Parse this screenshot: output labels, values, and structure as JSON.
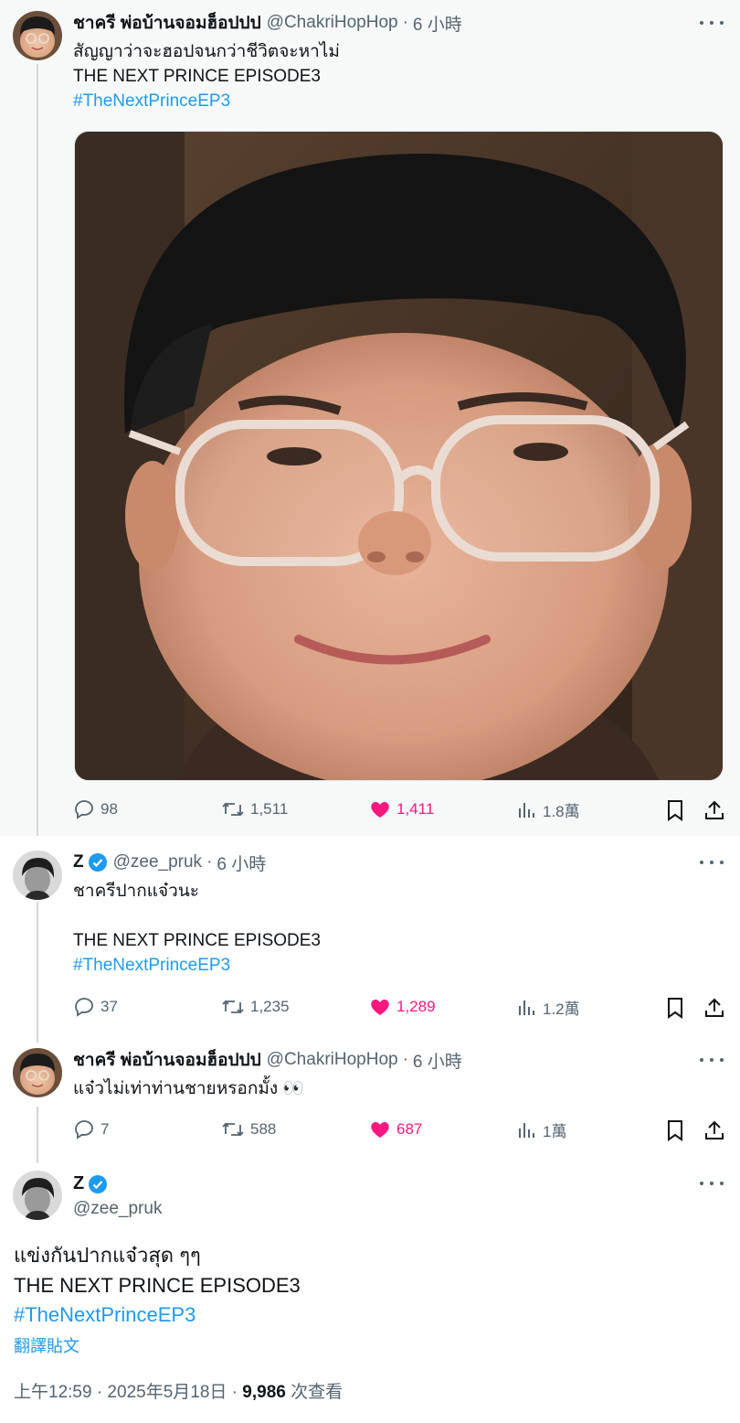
{
  "tweets": [
    {
      "name": "ชาครี พ่อบ้านจอมฮ็อปปป",
      "handle": "@ChakriHopHop",
      "time": "6 小時",
      "lines": [
        "สัญญาว่าจะฮอปจนกว่าชีวิตจะหาไม่",
        "THE NEXT PRINCE EPISODE3"
      ],
      "hashtag": "#TheNextPrinceEP3",
      "stats": {
        "replies": "98",
        "reposts": "1,511",
        "likes": "1,411",
        "views": "1.8萬"
      }
    },
    {
      "name": "Z",
      "handle": "@zee_pruk",
      "time": "6 小時",
      "lines": [
        "ชาครีปากแจ๋วนะ",
        "",
        "THE NEXT PRINCE EPISODE3"
      ],
      "hashtag": "#TheNextPrinceEP3",
      "stats": {
        "replies": "37",
        "reposts": "1,235",
        "likes": "1,289",
        "views": "1.2萬"
      }
    },
    {
      "name": "ชาครี พ่อบ้านจอมฮ็อปปป",
      "handle": "@ChakriHopHop",
      "time": "6 小時",
      "lines": [
        "แจ๋วไม่เท่าท่านชายหรอกมั้ง 👀"
      ],
      "stats": {
        "replies": "7",
        "reposts": "588",
        "likes": "687",
        "views": "1萬"
      }
    }
  ],
  "main": {
    "name": "Z",
    "handle": "@zee_pruk",
    "lines": [
      "แข่งกันปากแจ๋วสุด ๆๆ",
      "THE NEXT PRINCE EPISODE3"
    ],
    "hashtag": "#TheNextPrinceEP3",
    "translate": "翻譯貼文",
    "timestamp": "上午12:59 · 2025年5月18日 · ",
    "views_count": "9,986",
    "views_label": " 次查看"
  },
  "separator": " · ",
  "colors": {
    "accent": "#1d9bf0",
    "like": "#f91880",
    "muted": "#536471",
    "thread": "#cfd9de"
  },
  "icons": [
    "reply-icon",
    "repost-icon",
    "heart-icon",
    "views-icon",
    "bookmark-icon",
    "share-icon",
    "verified-icon",
    "more-icon"
  ]
}
